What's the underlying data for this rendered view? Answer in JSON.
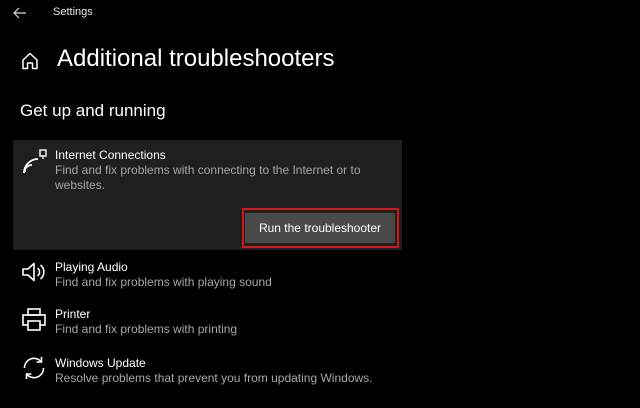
{
  "window": {
    "app_title": "Settings"
  },
  "page": {
    "title": "Additional troubleshooters",
    "section_title": "Get up and running"
  },
  "troubleshooters": [
    {
      "name": "Internet Connections",
      "description": "Find and fix problems with connecting to the Internet or to websites.",
      "icon": "wifi-signal-icon",
      "expanded": true,
      "button_label": "Run the troubleshooter"
    },
    {
      "name": "Playing Audio",
      "description": "Find and fix problems with playing sound",
      "icon": "speaker-icon"
    },
    {
      "name": "Printer",
      "description": "Find and fix problems with printing",
      "icon": "printer-icon"
    },
    {
      "name": "Windows Update",
      "description": "Resolve problems that prevent you from updating Windows.",
      "icon": "sync-icon"
    }
  ],
  "colors": {
    "background": "#000000",
    "card": "#1f1f1f",
    "button": "#4a4a4a",
    "highlight": "#d5171c",
    "secondary_text": "#a6a6a6"
  }
}
